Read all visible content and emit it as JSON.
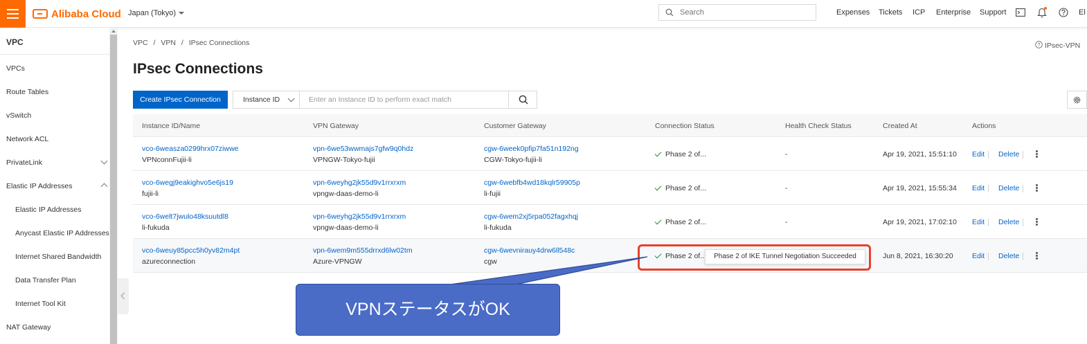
{
  "topbar": {
    "brand": "Alibaba Cloud",
    "region": "Japan (Tokyo)",
    "search_placeholder": "Search",
    "nav": [
      "Expenses",
      "Tickets",
      "ICP",
      "Enterprise",
      "Support"
    ],
    "lang": "El",
    "brand_color": "#ff6a00"
  },
  "sidebar": {
    "title": "VPC",
    "items": [
      "VPCs",
      "Route Tables",
      "vSwitch",
      "Network ACL",
      "PrivateLink",
      "Elastic IP Addresses",
      "Elastic IP Addresses",
      "Anycast Elastic IP Addresses",
      "Internet Shared Bandwidth",
      "Data Transfer Plan",
      "Internet Tool Kit",
      "NAT Gateway"
    ]
  },
  "breadcrumb": [
    "VPC",
    "VPN",
    "IPsec Connections"
  ],
  "help_link": "IPsec-VPN",
  "page_title": "IPsec Connections",
  "toolbar": {
    "create_label": "Create IPsec Connection",
    "filter_select": "Instance ID",
    "filter_placeholder": "Enter an Instance ID to perform exact match"
  },
  "table": {
    "columns": [
      "Instance ID/Name",
      "VPN Gateway",
      "Customer Gateway",
      "Connection Status",
      "Health Check Status",
      "Created At",
      "Actions"
    ],
    "rows": [
      {
        "id": "vco-6weasza0299hrx07ziwwe",
        "name": "VPNconnFujii-li",
        "vpn_id": "vpn-6we53wwmajs7gfw9q0hdz",
        "vpn_name": "VPNGW-Tokyo-fujii",
        "cgw_id": "cgw-6week0pfip7fa51n192ng",
        "cgw_name": "CGW-Tokyo-fujii-li",
        "status": "Phase 2 of...",
        "health": "-",
        "created": "Apr 19, 2021, 15:51:10"
      },
      {
        "id": "vco-6wegj9eakighvo5e6js19",
        "name": "fujii-li",
        "vpn_id": "vpn-6weyhg2jk55d9v1rrxrxm",
        "vpn_name": "vpngw-daas-demo-li",
        "cgw_id": "cgw-6webfb4wd18kqlr59905p",
        "cgw_name": "li-fujii",
        "status": "Phase 2 of...",
        "health": "-",
        "created": "Apr 19, 2021, 15:55:34"
      },
      {
        "id": "vco-6welt7jwulo48ksuutdl8",
        "name": "li-fukuda",
        "vpn_id": "vpn-6weyhg2jk55d9v1rrxrxm",
        "vpn_name": "vpngw-daas-demo-li",
        "cgw_id": "cgw-6wem2xj5rpa052fagxhqj",
        "cgw_name": "li-fukuda",
        "status": "Phase 2 of...",
        "health": "-",
        "created": "Apr 19, 2021, 17:02:10"
      },
      {
        "id": "vco-6weuy85pcc5h0yv82m4pt",
        "name": "azureconnection",
        "vpn_id": "vpn-6wem9m555drrxd6lw02tm",
        "vpn_name": "Azure-VPNGW",
        "cgw_id": "cgw-6wevnirauy4drw6ll548c",
        "cgw_name": "cgw",
        "status": "Phase 2 of...",
        "health": "",
        "created": "Jun 8, 2021, 16:30:20"
      }
    ],
    "edit_label": "Edit",
    "delete_label": "Delete"
  },
  "tooltip": "Phase 2 of IKE Tunnel Negotiation Succeeded",
  "annotation": {
    "callout": "VPNステータスがOK",
    "highlight_color": "#e8402a",
    "callout_color": "#4a6cc7"
  },
  "colors": {
    "link": "#0064c8",
    "primary": "#0064c8",
    "success": "#1e8e3e"
  }
}
